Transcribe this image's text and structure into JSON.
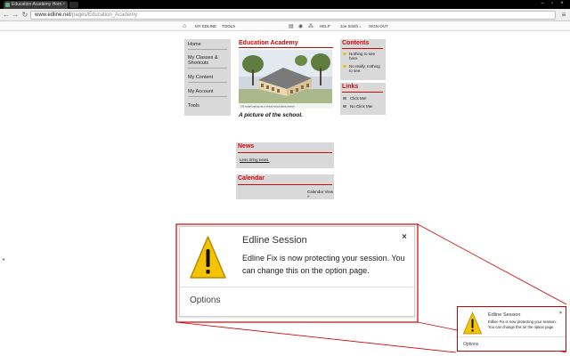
{
  "browser": {
    "tab_title": "Education Academy Hom",
    "tab_close": "×",
    "win_min": "–",
    "win_max": "▫",
    "win_close": "×",
    "back_icon": "←",
    "forward_icon": "→",
    "reload_icon": "↻",
    "url_host": "www.edline.net",
    "url_path": "/pages/Education_Academy",
    "menu_icon": "≡"
  },
  "site": {
    "topnav": {
      "my_edline": "MY EDLINE",
      "tools": "TOOLS",
      "help": "HELP",
      "user": "Joe Smith  ↓",
      "sign_out": "SIGN OUT"
    },
    "sidebar": [
      {
        "label": "Home"
      },
      {
        "label": "My Classes & Shortcuts"
      },
      {
        "label": "My Content"
      },
      {
        "label": "My Account"
      },
      {
        "label": "Tools"
      }
    ],
    "main_title": "Education Academy",
    "photo_caption_small": "3-D model looking into a Virtual school district sketch",
    "caption": "A picture of the school.",
    "contents": {
      "title": "Contents",
      "items": [
        {
          "label": "Nothing to see here."
        },
        {
          "label": "No really, nothing to see."
        }
      ]
    },
    "links": {
      "title": "Links",
      "items": [
        {
          "label": "Click Me!"
        },
        {
          "label": "No Click Me!"
        }
      ]
    },
    "news": {
      "title": "News",
      "text": "Less tiring news."
    },
    "calendar": {
      "title": "Calendar",
      "link": "Calendar View »"
    }
  },
  "notification_large": {
    "title": "Edline Session",
    "body": "Edline Fix is now protecting your session. You can change this on the option page.",
    "close": "×",
    "options": "Options"
  },
  "notification_small": {
    "title": "Edline Session",
    "body": "Edline Fix is now protecting your session. You can change this on the option page.",
    "close": "×",
    "options": "Options"
  },
  "colors": {
    "accent_red": "#cc0a0a",
    "warning_yellow": "#f5c400",
    "panel_gray": "#d9d9d9"
  }
}
